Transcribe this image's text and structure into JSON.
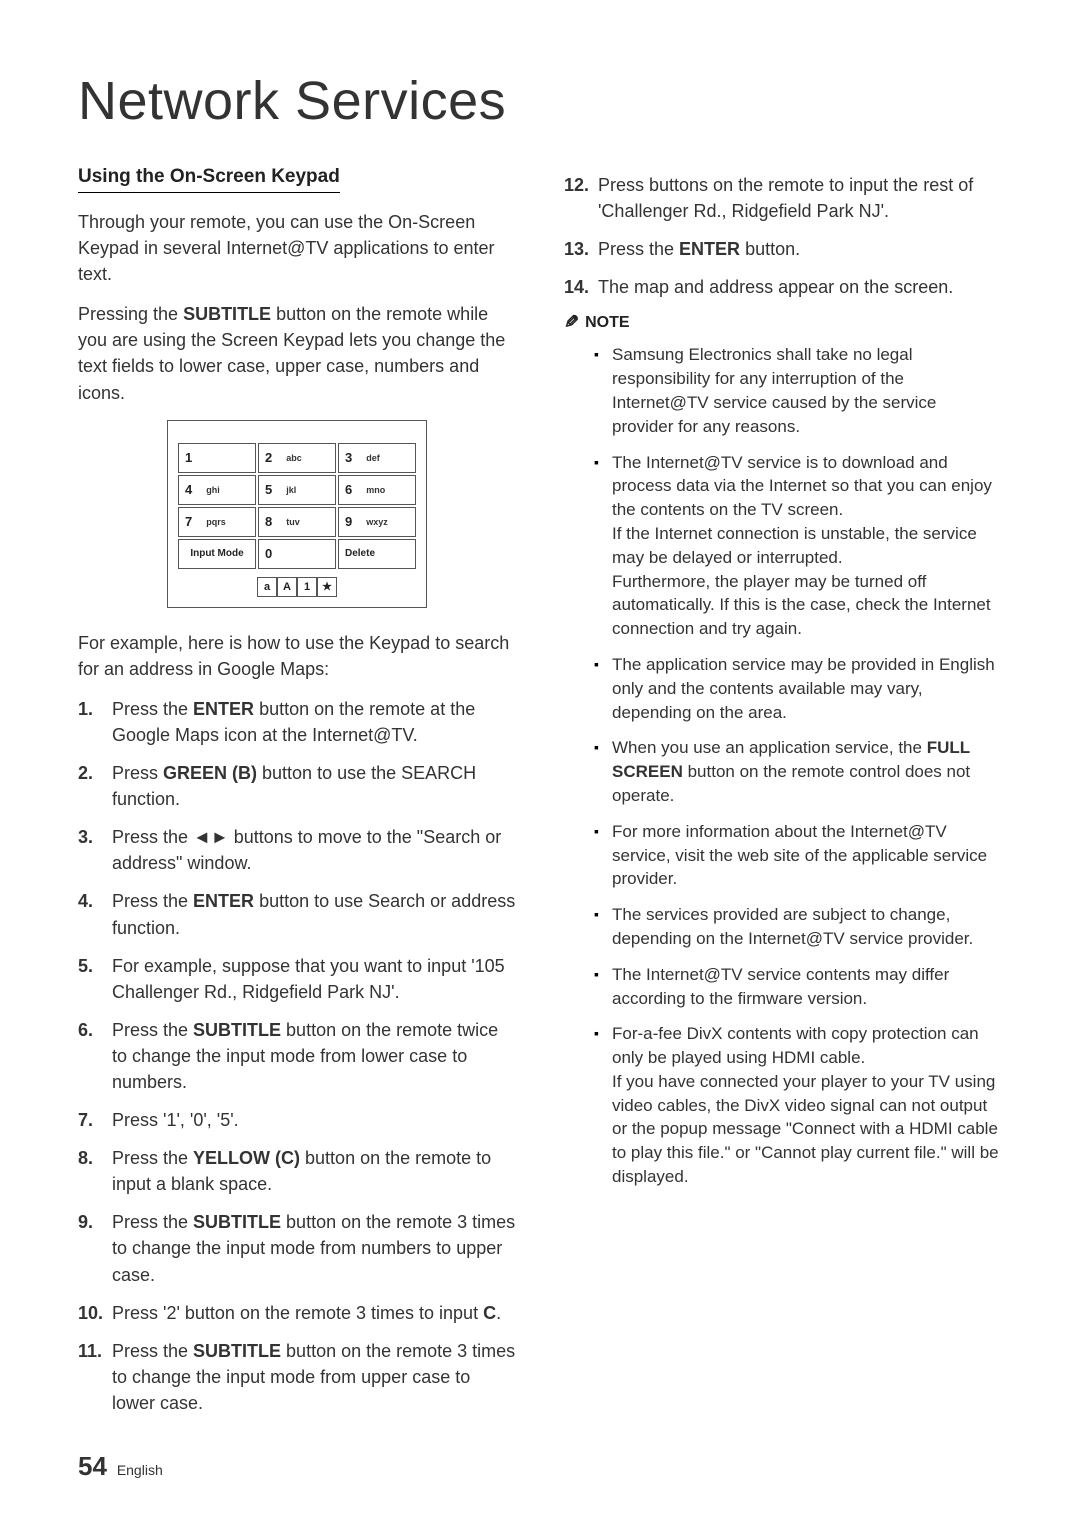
{
  "title": "Network Services",
  "left": {
    "heading": "Using the On-Screen Keypad",
    "p1": "Through your remote, you can use the On-Screen Keypad in several Internet@TV applications to enter text.",
    "p2_a": "Pressing the ",
    "p2_b": "SUBTITLE",
    "p2_c": " button on the remote while you are using the Screen Keypad lets you change the text fields to lower case, upper case, numbers and icons.",
    "keypad": {
      "k1": "1",
      "k2": "2",
      "k2s": "abc",
      "k3": "3",
      "k3s": "def",
      "k4": "4",
      "k4s": "ghi",
      "k5": "5",
      "k5s": "jkl",
      "k6": "6",
      "k6s": "mno",
      "k7": "7",
      "k7s": "pqrs",
      "k8": "8",
      "k8s": "tuv",
      "k9": "9",
      "k9s": "wxyz",
      "input": "Input Mode",
      "k0": "0",
      "del": "Delete",
      "m_a": "a",
      "m_A": "A",
      "m_1": "1",
      "m_star": "★"
    },
    "p3": "For example, here is how to use the Keypad to search for an address in Google Maps:",
    "steps": {
      "s1a": "Press the ",
      "s1b": "ENTER",
      "s1c": " button on the remote at the Google Maps icon at the Internet@TV.",
      "s2a": "Press ",
      "s2b": "GREEN (B)",
      "s2c": " button to use the SEARCH function.",
      "s3a": "Press the ",
      "s3b": "◄►",
      "s3c": " buttons to move to the \"Search or address\" window.",
      "s4a": "Press the ",
      "s4b": "ENTER",
      "s4c": " button to use Search or address function.",
      "s5": "For example, suppose that you want to input '105 Challenger Rd., Ridgefield Park NJ'.",
      "s6a": "Press the ",
      "s6b": "SUBTITLE",
      "s6c": " button on the remote twice to change the input mode from lower case to numbers.",
      "s7": "Press '1', '0', '5'.",
      "s8a": "Press the ",
      "s8b": "YELLOW (C)",
      "s8c": " button on the remote to input a blank space.",
      "s9a": "Press the ",
      "s9b": "SUBTITLE",
      "s9c": " button on the remote 3 times to change the input mode from numbers to upper case.",
      "s10a": "Press '2' button on the remote 3 times to input ",
      "s10b": "C",
      "s10c": ".",
      "s11a": "Press the ",
      "s11b": "SUBTITLE",
      "s11c": " button on the remote 3 times to change the input mode from upper case to lower case."
    }
  },
  "right": {
    "steps": {
      "s12": "Press buttons on the remote to input the rest of 'Challenger Rd., Ridgefield Park NJ'.",
      "s13a": "Press the ",
      "s13b": "ENTER",
      "s13c": " button.",
      "s14": "The map and address appear on the screen."
    },
    "note_label": "NOTE",
    "notes": {
      "n1": "Samsung Electronics shall take no legal responsibility for any interruption of the Internet@TV service caused by the service provider for any reasons.",
      "n2": "The Internet@TV service is to download and process data via the Internet so that you can enjoy the contents on the TV screen.\nIf the Internet connection is unstable, the service may be delayed or interrupted.\nFurthermore, the player may be turned off automatically. If this is the case, check the Internet connection and try again.",
      "n3": "The application service may be provided in English only and the contents available may vary, depending on the area.",
      "n4a": "When you use an application service, the ",
      "n4b": "FULL SCREEN",
      "n4c": " button on the remote control does not operate.",
      "n5": "For more information about the Internet@TV service, visit the web site of the applicable service provider.",
      "n6": "The services provided are subject to change, depending on the Internet@TV service provider.",
      "n7": "The Internet@TV service contents may differ according to the firmware version.",
      "n8": "For-a-fee DivX contents with copy protection can only be played using HDMI cable.\nIf you have connected your player to your TV using video cables, the DivX video signal can not output or the popup message \"Connect with a HDMI cable to play this file.\" or \"Cannot play current file.\" will be displayed."
    }
  },
  "footer": {
    "page": "54",
    "lang": "English"
  }
}
